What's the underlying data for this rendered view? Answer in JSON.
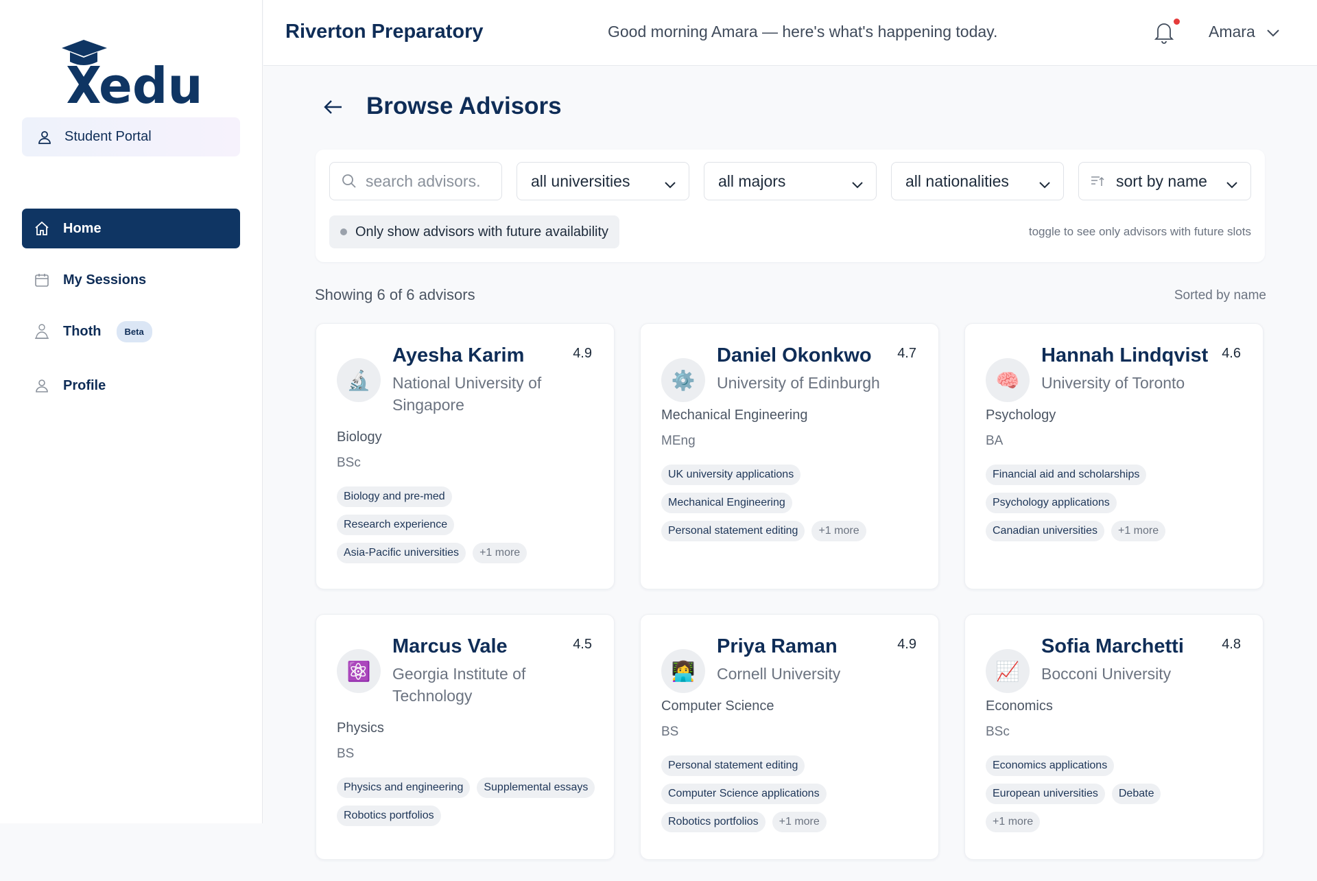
{
  "brand": {
    "logo_text": "Xedu",
    "color": "#0f3563"
  },
  "sidebar": {
    "portal_label": "Student Portal",
    "items": [
      {
        "label": "Home",
        "icon": "home-icon",
        "active": true
      },
      {
        "label": "My Sessions",
        "icon": "calendar-icon"
      },
      {
        "label": "Thoth",
        "icon": "thoth-icon",
        "badge": "Beta"
      },
      {
        "label": "Profile",
        "icon": "user-icon"
      }
    ]
  },
  "header": {
    "school": "Riverton Preparatory",
    "greeting": "Good morning Amara — here's what's happening today.",
    "user": "Amara",
    "notification_dot_color": "#e53b3b"
  },
  "page": {
    "title": "Browse Advisors"
  },
  "filters": {
    "search_placeholder": "search advisors.",
    "universities": "all universities",
    "majors": "all majors",
    "nationalities": "all nationalities",
    "sort": "sort by name",
    "availability_toggle": "Only show advisors with future availability",
    "toggle_hint": "toggle to see only advisors with future slots"
  },
  "results": {
    "showing": "Showing 6 of 6 advisors",
    "sorted": "Sorted by name"
  },
  "advisors": [
    {
      "name": "Ayesha Karim",
      "university": "National University of Singapore",
      "rating": "4.9",
      "major": "Biology",
      "degree": "BSc",
      "avatar": "🔬",
      "tags": [
        "Biology and pre-med",
        "Research experience",
        "Asia-Pacific universities"
      ],
      "more": "+1 more"
    },
    {
      "name": "Daniel Okonkwo",
      "university": "University of Edinburgh",
      "rating": "4.7",
      "major": "Mechanical Engineering",
      "degree": "MEng",
      "avatar": "⚙️",
      "tags": [
        "UK university applications",
        "Mechanical Engineering",
        "Personal statement editing"
      ],
      "more": "+1 more"
    },
    {
      "name": "Hannah Lindqvist",
      "university": "University of Toronto",
      "rating": "4.6",
      "major": "Psychology",
      "degree": "BA",
      "avatar": "🧠",
      "tags": [
        "Financial aid and scholarships",
        "Psychology applications",
        "Canadian universities"
      ],
      "more": "+1 more"
    },
    {
      "name": "Marcus Vale",
      "university": "Georgia Institute of Technology",
      "rating": "4.5",
      "major": "Physics",
      "degree": "BS",
      "avatar": "⚛️",
      "tags": [
        "Physics and engineering",
        "Supplemental essays",
        "Robotics portfolios"
      ],
      "more": ""
    },
    {
      "name": "Priya Raman",
      "university": "Cornell University",
      "rating": "4.9",
      "major": "Computer Science",
      "degree": "BS",
      "avatar": "👩‍💻",
      "tags": [
        "Personal statement editing",
        "Computer Science applications",
        "Robotics portfolios"
      ],
      "more": "+1 more"
    },
    {
      "name": "Sofia Marchetti",
      "university": "Bocconi University",
      "rating": "4.8",
      "major": "Economics",
      "degree": "BSc",
      "avatar": "📈",
      "tags": [
        "Economics applications",
        "European universities",
        "Debate"
      ],
      "more": "+1 more"
    }
  ]
}
